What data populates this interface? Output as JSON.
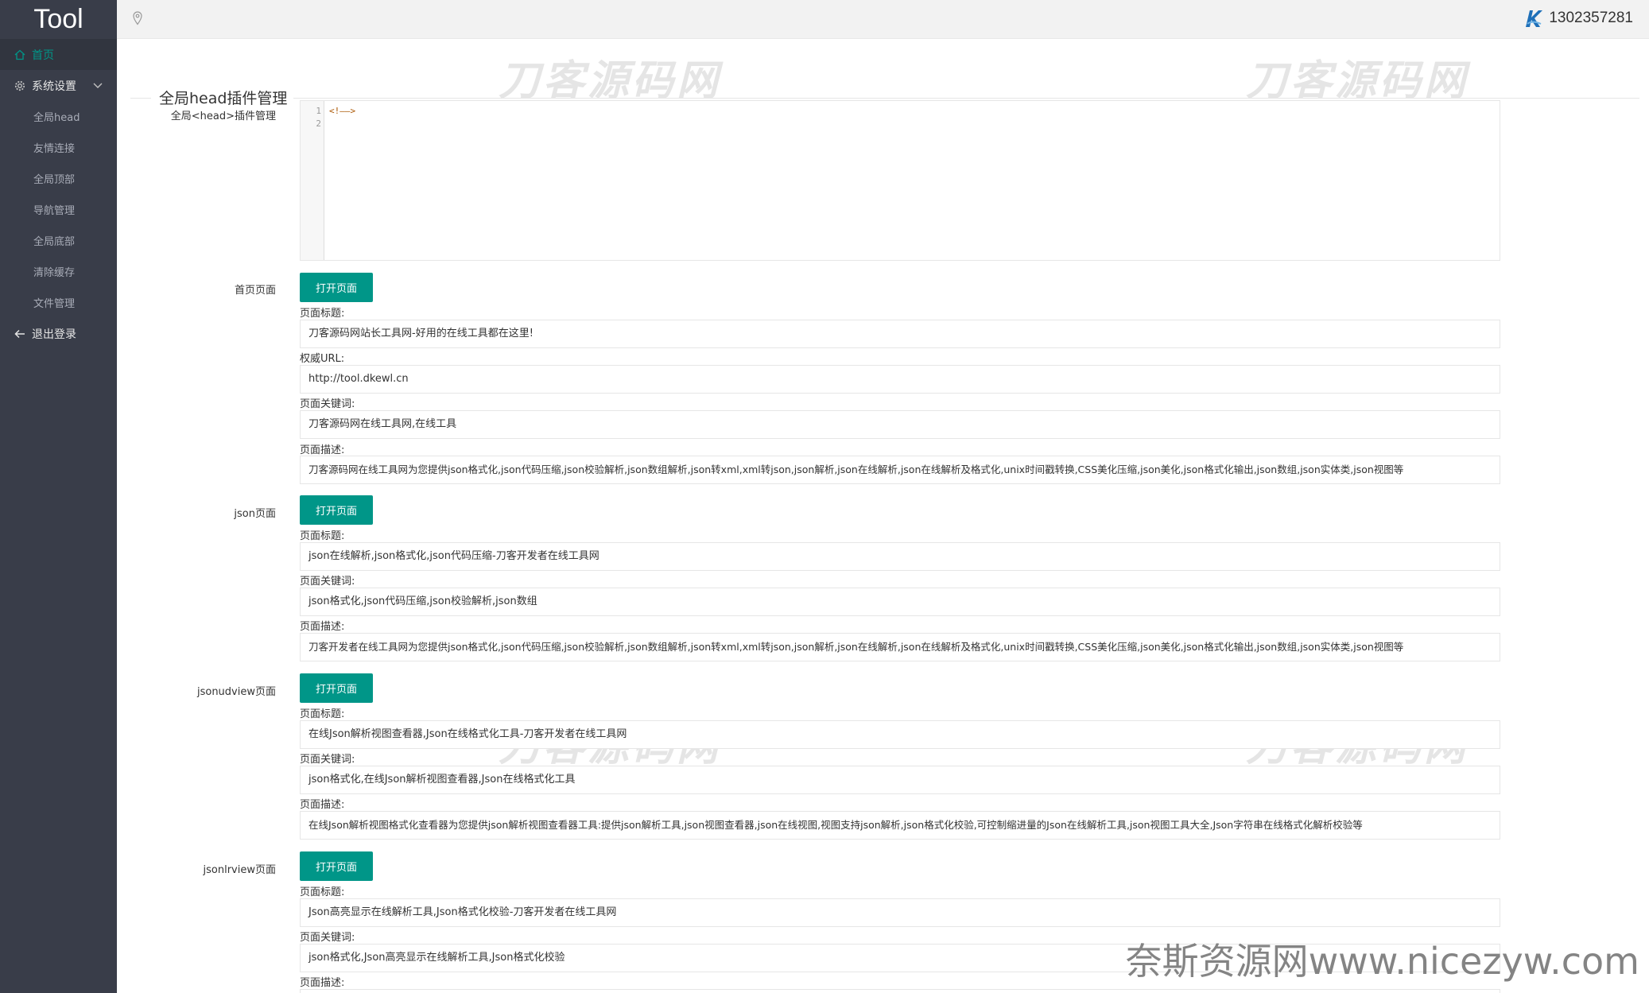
{
  "app": {
    "logo": "Tool",
    "user_id": "1302357281"
  },
  "sidebar": {
    "home": "首页",
    "settings": "系统设置",
    "sub_items": [
      "全局head",
      "友情连接",
      "全局顶部",
      "导航管理",
      "全局底部",
      "清除缓存",
      "文件管理"
    ],
    "logout": "退出登录"
  },
  "page": {
    "title": "全局head插件管理",
    "head_label": "全局<head>插件管理",
    "editor_lines": [
      "1",
      "2"
    ],
    "editor_code": "<!——>"
  },
  "labels": {
    "open_page": "打开页面",
    "page_title": "页面标题:",
    "canonical_url": "权威URL:",
    "page_keywords": "页面关键词:",
    "page_desc": "页面描述:"
  },
  "sections": [
    {
      "name": "首页页面",
      "title": "刀客源码网站长工具网-好用的在线工具都在这里!",
      "url": "http://tool.dkewl.cn",
      "keywords": "刀客源码网在线工具网,在线工具",
      "desc": "刀客源码网在线工具网为您提供json格式化,json代码压缩,json校验解析,json数组解析,json转xml,xml转json,json解析,json在线解析,json在线解析及格式化,unix时间戳转换,CSS美化压缩,json美化,json格式化输出,json数组,json实体类,json视图等"
    },
    {
      "name": "json页面",
      "title": "json在线解析,json格式化,json代码压缩-刀客开发者在线工具网",
      "keywords": "json格式化,json代码压缩,json校验解析,json数组",
      "desc": "刀客开发者在线工具网为您提供json格式化,json代码压缩,json校验解析,json数组解析,json转xml,xml转json,json解析,json在线解析,json在线解析及格式化,unix时间戳转换,CSS美化压缩,json美化,json格式化输出,json数组,json实体类,json视图等"
    },
    {
      "name": "jsonudview页面",
      "title": "在线Json解析视图查看器,Json在线格式化工具-刀客开发者在线工具网",
      "keywords": "json格式化,在线Json解析视图查看器,Json在线格式化工具",
      "desc": "在线Json解析视图格式化查看器为您提供json解析视图查看器工具:提供json解析工具,json视图查看器,json在线视图,视图支持json解析,json格式化校验,可控制缩进量的Json在线解析工具,json视图工具大全,Json字符串在线格式化解析校验等"
    },
    {
      "name": "jsonlrview页面",
      "title": "Json高亮显示在线解析工具,Json格式化校验-刀客开发者在线工具网",
      "keywords": "json格式化,Json高亮显示在线解析工具,Json格式化校验"
    }
  ],
  "watermarks": {
    "brand": "刀客源码网",
    "site": "奈斯资源网www.nicezyw.com"
  }
}
